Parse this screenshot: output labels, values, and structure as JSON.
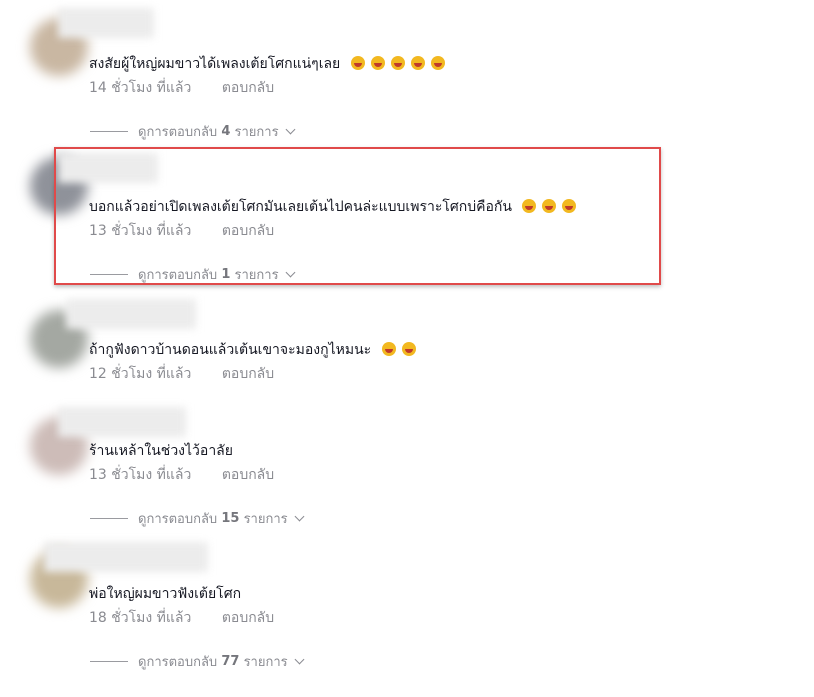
{
  "comments": [
    {
      "text": "สงสัยผู้ใหญ่ผมขาวได้เพลงเต้ยโศกแน่ๆเลย",
      "emoji_count": 5,
      "time": "14 ชั่วโมง ที่แล้ว",
      "reply": "ตอบกลับ",
      "view_prefix": "ดูการตอบกลับ",
      "count": "4",
      "view_suffix": "รายการ"
    },
    {
      "text": "บอกแล้วอย่าเปิดเพลงเต้ยโศกมันเลยเต้นไปคนล่ะแบบเพราะโศกบ่คือกัน",
      "emoji_count": 3,
      "time": "13 ชั่วโมง ที่แล้ว",
      "reply": "ตอบกลับ",
      "view_prefix": "ดูการตอบกลับ",
      "count": "1",
      "view_suffix": "รายการ"
    },
    {
      "text": "ถ้ากูฟังดาวบ้านดอนแล้วเต้นเขาจะมองกูไหมนะ",
      "emoji_count": 2,
      "time": "12 ชั่วโมง ที่แล้ว",
      "reply": "ตอบกลับ"
    },
    {
      "text": "ร้านเหล้าในช่วงไว้อาลัย",
      "emoji_count": 0,
      "time": "13 ชั่วโมง ที่แล้ว",
      "reply": "ตอบกลับ",
      "view_prefix": "ดูการตอบกลับ",
      "count": "15",
      "view_suffix": "รายการ"
    },
    {
      "text": "พ่อใหญ่ผมขาวฟังเต้ยโศก",
      "emoji_count": 0,
      "time": "18 ชั่วโมง ที่แล้ว",
      "reply": "ตอบกลับ",
      "view_prefix": "ดูการตอบกลับ",
      "count": "77",
      "view_suffix": "รายการ"
    }
  ],
  "highlight_color": "#e04a4a",
  "emoji_icon": "laughing-face-icon"
}
